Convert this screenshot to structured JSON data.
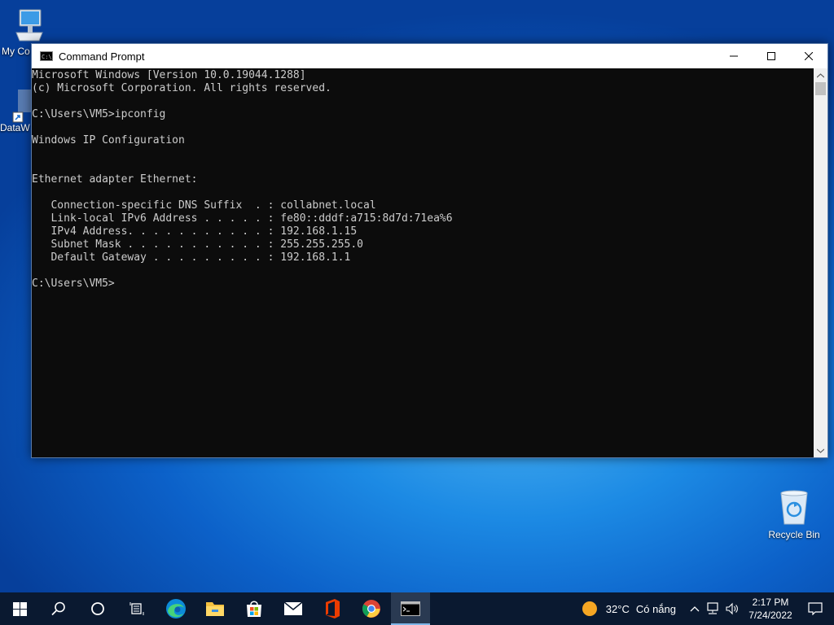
{
  "desktop": {
    "icons": [
      {
        "label": "My Co"
      },
      {
        "label": "DataW"
      },
      {
        "label": "Recycle Bin"
      }
    ]
  },
  "window": {
    "title": "Command Prompt",
    "icon": "cmd-icon",
    "console_lines": [
      "Microsoft Windows [Version 10.0.19044.1288]",
      "(c) Microsoft Corporation. All rights reserved.",
      "",
      "C:\\Users\\VM5>ipconfig",
      "",
      "Windows IP Configuration",
      "",
      "",
      "Ethernet adapter Ethernet:",
      "",
      "   Connection-specific DNS Suffix  . : collabnet.local",
      "   Link-local IPv6 Address . . . . . : fe80::dddf:a715:8d7d:71ea%6",
      "   IPv4 Address. . . . . . . . . . . : 192.168.1.15",
      "   Subnet Mask . . . . . . . . . . . : 255.255.255.0",
      "   Default Gateway . . . . . . . . . : 192.168.1.1",
      "",
      "C:\\Users\\VM5>"
    ]
  },
  "taskbar": {
    "items": [
      "start-icon",
      "search-icon",
      "task-view-icon",
      "widgets-icon",
      "edge-icon",
      "file-explorer-icon",
      "store-icon",
      "mail-icon",
      "office-icon",
      "chrome-icon",
      "command-prompt-icon"
    ],
    "weather_temp": "32°C",
    "weather_text": "Có nắng",
    "time": "2:17 PM",
    "date": "7/24/2022"
  },
  "colors": {
    "console_bg": "#0c0c0c",
    "console_fg": "#cccccc",
    "taskbar_bg": "#0a1930"
  }
}
